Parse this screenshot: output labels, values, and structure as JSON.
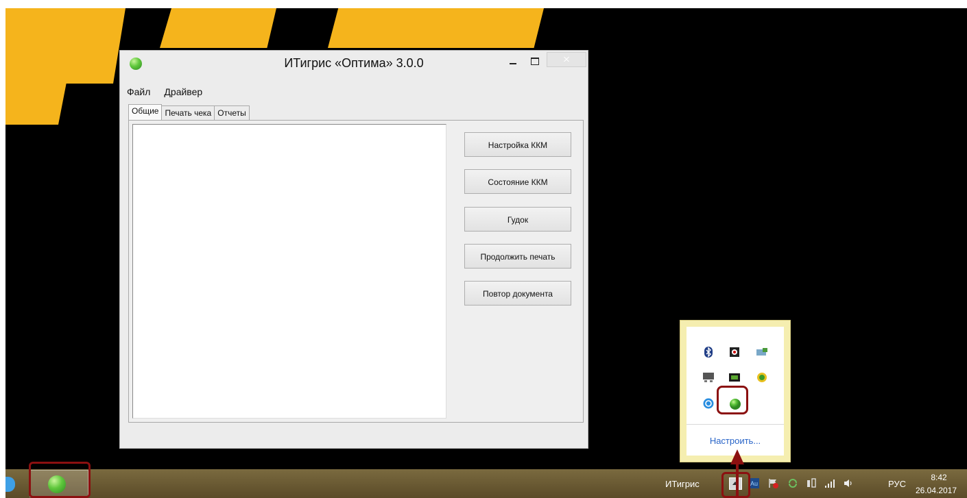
{
  "window": {
    "title": "ИТигрис «Оптима» 3.0.0",
    "menu": [
      "Файл",
      "Драйвер"
    ],
    "tabs": [
      "Общие",
      "Печать чека",
      "Отчеты"
    ],
    "active_tab": "Общие",
    "buttons": [
      "Настройка ККМ",
      "Состояние ККМ",
      "Гудок",
      "Продолжить печать",
      "Повтор документа"
    ]
  },
  "tray_popup": {
    "icons": [
      "bluetooth-icon",
      "camera-icon",
      "network-card-icon",
      "display-icon",
      "gpu-icon",
      "update-icon",
      "sync-icon",
      "itigris-app-icon"
    ],
    "customize_label": "Настроить..."
  },
  "taskbar": {
    "toolbar_label": "ИТигрис",
    "language": "РУС",
    "time": "8:42",
    "date": "26.04.2017"
  },
  "colors": {
    "wallpaper_accent": "#f5b41c",
    "annotation": "#8b1010",
    "link": "#2864c8"
  }
}
